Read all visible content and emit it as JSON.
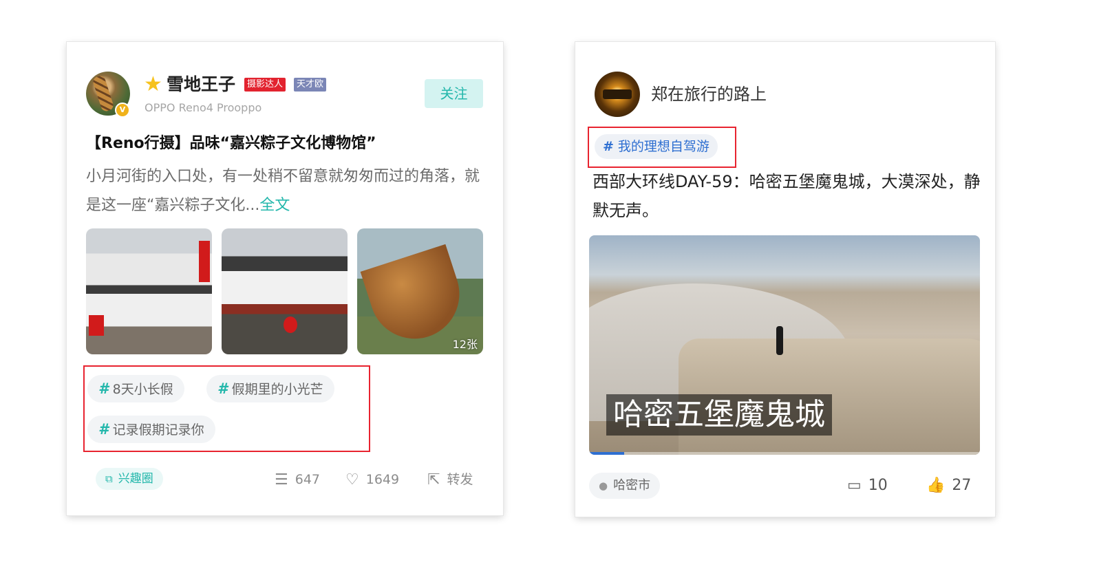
{
  "post1": {
    "username": "雪地王子",
    "badge_photographer": "摄影达人",
    "badge_genius": "天才欧",
    "device": "OPPO Reno4 Prooppo",
    "verify_mark": "V",
    "follow_label": "关注",
    "title": "【Reno行摄】品味“嘉兴粽子文化博物馆”",
    "body": "小月河街的入口处，有一处稍不留意就匆匆而过的角落，就是这一座“嘉兴粽子文化...",
    "more_label": "全文",
    "image_count": "12张",
    "tags": [
      "8天小长假",
      "假期里的小光芒",
      "记录假期记录你"
    ],
    "interest_label": "兴趣圈",
    "comments": "647",
    "likes": "1649",
    "share_label": "转发",
    "icons": {
      "star": "star-icon",
      "hash": "#",
      "interest": "circle-group-icon",
      "comment": "comment-icon",
      "like": "heart-icon",
      "share": "share-icon"
    },
    "accent_color": "#23b7ab"
  },
  "post2": {
    "username": "郑在旅行的路上",
    "topic": "我的理想自驾游",
    "body": "西部大环线DAY-59：哈密五堡魔鬼城，大漠深处，静默无声。",
    "video_caption": "哈密五堡魔鬼城",
    "video_progress": 0.09,
    "location": "哈密市",
    "comments": "10",
    "likes": "27",
    "accent_color": "#2e6fd1"
  },
  "highlight_color": "#e8232f"
}
